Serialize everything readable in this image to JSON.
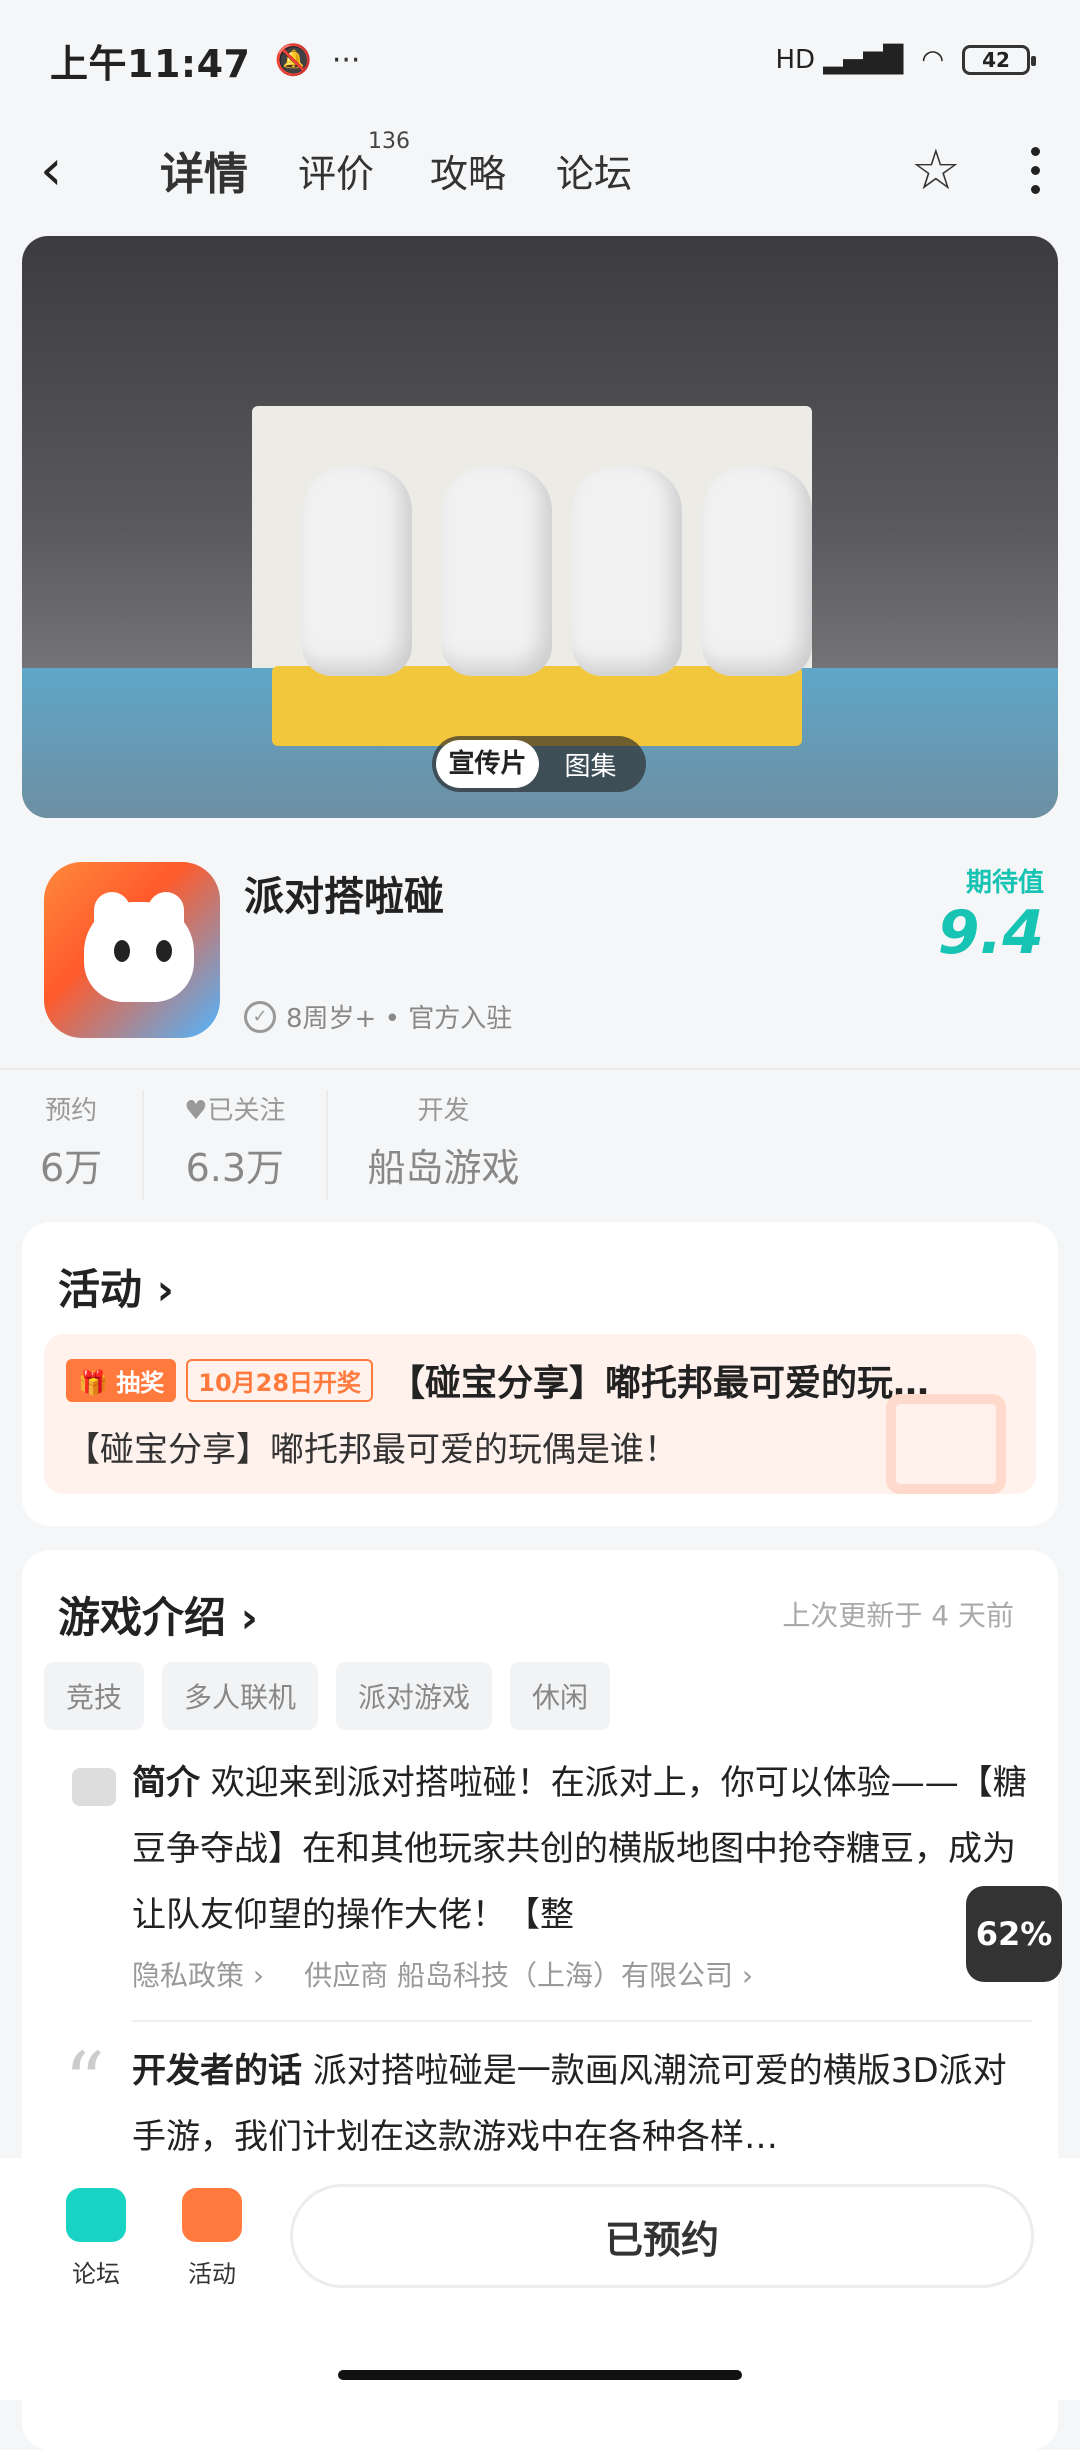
{
  "status": {
    "time": "上午11:47",
    "more": "···",
    "network": "HD",
    "battery": "42"
  },
  "nav": {
    "tabs": [
      {
        "label": "详情"
      },
      {
        "label": "评价",
        "count": "136"
      },
      {
        "label": "攻略"
      },
      {
        "label": "论坛"
      }
    ]
  },
  "hero": {
    "toggle_video": "宣传片",
    "toggle_gallery": "图集"
  },
  "game": {
    "name": "派对搭啦碰",
    "meta": "8周岁+ • 官方入驻",
    "expect_label": "期待值",
    "expect_value": "9.4"
  },
  "stats": [
    {
      "key": "预约",
      "value": "6万"
    },
    {
      "key": "已关注",
      "value": "6.3万"
    },
    {
      "key": "开发",
      "value": "船岛游戏"
    }
  ],
  "activity": {
    "title": "活动 ›",
    "badge": "抽奖",
    "date": "10月28日开奖",
    "head": "【碰宝分享】嘟托邦最可爱的玩…",
    "body": "【碰宝分享】嘟托邦最可爱的玩偶是谁！"
  },
  "intro": {
    "title": "游戏介绍 ›",
    "updated": "上次更新于 4 天前",
    "tags": [
      "竞技",
      "多人联机",
      "派对游戏",
      "休闲"
    ],
    "desc_label": "简介",
    "desc_text": " 欢迎来到派对搭啦碰！在派对上，你可以体验——【糖豆争夺战】在和其他玩家共创的横版地图中抢夺糖豆，成为让队友仰望的操作大佬！【整",
    "privacy": "隐私政策 ›",
    "supplier": "供应商 船岛科技（上海）有限公司 ›",
    "dev_label": "开发者的话",
    "dev_text": " 派对搭啦碰是一款画风潮流可爱的横版3D派对手游，我们计划在这款游戏中在各种各样…"
  },
  "floating_percent": "62%",
  "bottom": {
    "forum": "论坛",
    "activity": "活动",
    "reserve": "已预约"
  },
  "colors": {
    "accent": "#19d3c5",
    "orange": "#ff7a3c"
  }
}
